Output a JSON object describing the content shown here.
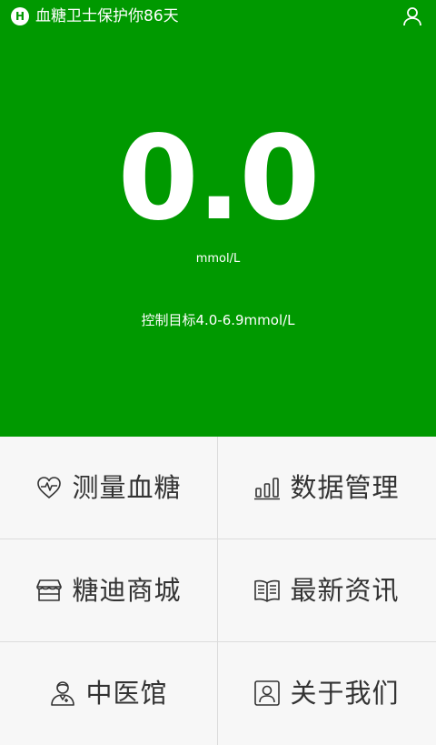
{
  "header": {
    "logo_letter": "H",
    "title": "血糖卫士保护你86天"
  },
  "reading": {
    "value": "0.0",
    "unit": "mmol/L",
    "target": "控制目标4.0-6.9mmol/L"
  },
  "colors": {
    "brand_green": "#009900",
    "grid_bg": "#f7f7f7",
    "label_text": "#333333"
  },
  "menu": [
    {
      "label": "测量血糖",
      "icon": "heart-pulse-icon"
    },
    {
      "label": "数据管理",
      "icon": "bar-chart-icon"
    },
    {
      "label": "糖迪商城",
      "icon": "shop-icon"
    },
    {
      "label": "最新资讯",
      "icon": "book-icon"
    },
    {
      "label": "中医馆",
      "icon": "doctor-icon"
    },
    {
      "label": "关于我们",
      "icon": "contact-card-icon"
    }
  ]
}
